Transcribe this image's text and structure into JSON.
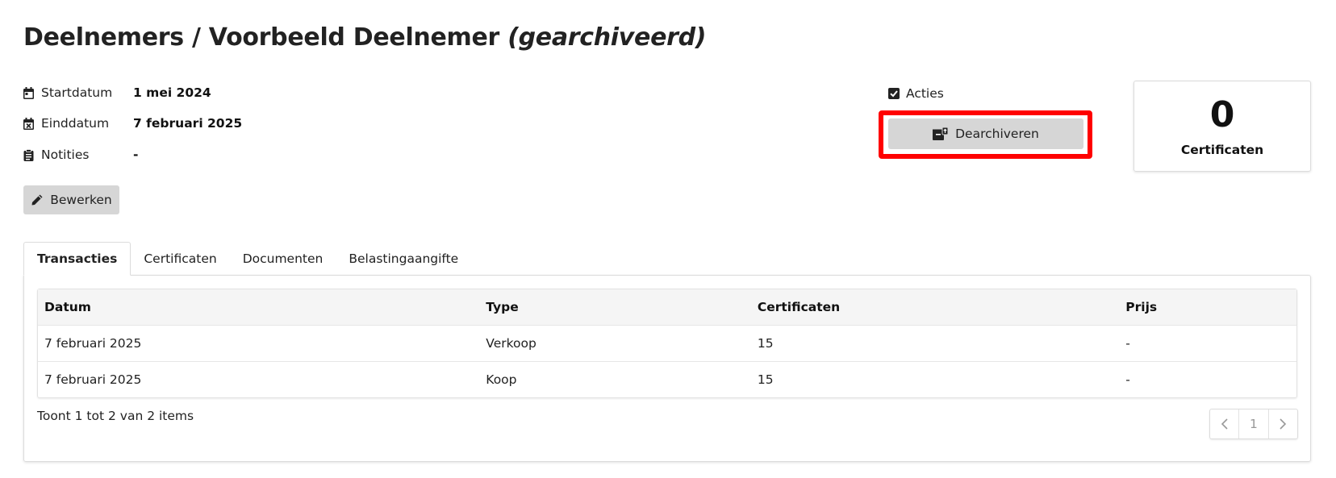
{
  "page": {
    "title_main": "Deelnemers / Voorbeeld Deelnemer ",
    "title_status": "(gearchiveerd)"
  },
  "details": [
    {
      "icon": "calendar-icon",
      "label": "Startdatum",
      "value": "1 mei 2024"
    },
    {
      "icon": "calendar-x-icon",
      "label": "Einddatum",
      "value": "7 februari 2025"
    },
    {
      "icon": "clipboard-icon",
      "label": "Notities",
      "value": "-"
    }
  ],
  "edit_button": {
    "label": "Bewerken",
    "icon": "pencil-icon"
  },
  "actions": {
    "label": "Acties",
    "checked": true,
    "dearchive_label": "Dearchiveren",
    "dearchive_icon": "unarchive-icon",
    "highlight_color": "#ff0000"
  },
  "stat": {
    "value": "0",
    "label": "Certificaten"
  },
  "tabs": [
    {
      "label": "Transacties",
      "active": true
    },
    {
      "label": "Certificaten",
      "active": false
    },
    {
      "label": "Documenten",
      "active": false
    },
    {
      "label": "Belastingaangifte",
      "active": false
    }
  ],
  "table": {
    "columns": [
      "Datum",
      "Type",
      "Certificaten",
      "Prijs"
    ],
    "rows": [
      [
        "7 februari 2025",
        "Verkoop",
        "15",
        "-"
      ],
      [
        "7 februari 2025",
        "Koop",
        "15",
        "-"
      ]
    ],
    "footer": "Toont 1 tot 2 van 2 items"
  },
  "pagination": {
    "current": "1",
    "prev_icon": "chevron-left-icon",
    "next_icon": "chevron-right-icon"
  }
}
